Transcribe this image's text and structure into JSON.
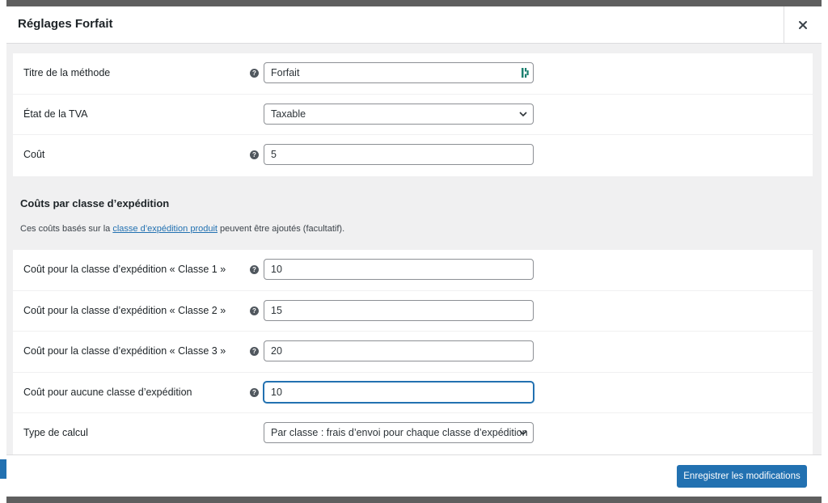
{
  "modal": {
    "title": "Réglages Forfait",
    "close_icon": "close-icon"
  },
  "method_settings": [
    {
      "label": "Titre de la méthode",
      "value": "Forfait",
      "type": "text",
      "help": true,
      "help_symbol": "?",
      "password_manager_icon": true
    },
    {
      "label": "État de la TVA",
      "value": "Taxable",
      "type": "select",
      "help": false
    },
    {
      "label": "Coût",
      "value": "5",
      "type": "text",
      "help": true,
      "help_symbol": "?"
    }
  ],
  "shipping_class_section": {
    "title": "Coûts par classe d’expédition",
    "description_before": "Ces coûts basés sur la ",
    "description_link": "classe d’expédition produit",
    "description_after": " peuvent être ajoutés (facultatif)."
  },
  "class_costs": [
    {
      "label": "Coût pour la classe d’expédition « Classe 1 »",
      "value": "10",
      "help": true,
      "help_symbol": "?"
    },
    {
      "label": "Coût pour la classe d’expédition « Classe 2 »",
      "value": "15",
      "help": true,
      "help_symbol": "?"
    },
    {
      "label": "Coût pour la classe d’expédition « Classe 3 »",
      "value": "20",
      "help": true,
      "help_symbol": "?"
    },
    {
      "label": "Coût pour aucune classe d’expédition",
      "value": "10",
      "help": true,
      "help_symbol": "?",
      "focused": true
    },
    {
      "label": "Type de calcul",
      "value": "Par classe : frais d’envoi pour chaque classe d’expédition",
      "type": "select",
      "help": false
    }
  ],
  "footer": {
    "save_label": "Enregistrer les modifications"
  },
  "colors": {
    "accent": "#2271b1",
    "overlay": "#5f5f5f",
    "panel": "#ffffff",
    "body_bg": "#f0f0f1"
  }
}
